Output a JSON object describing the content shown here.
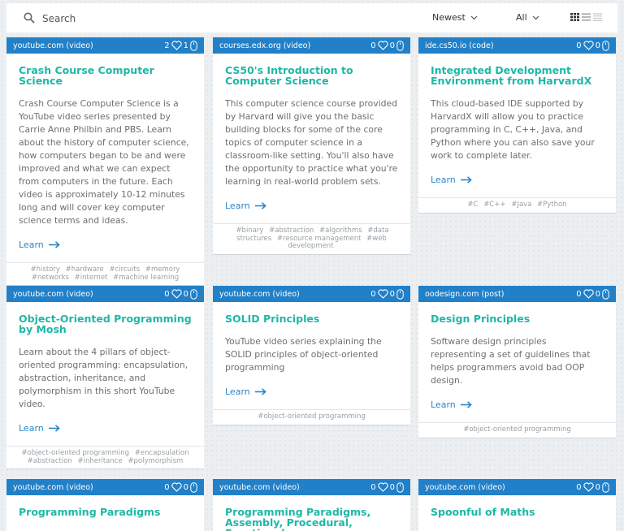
{
  "search": {
    "placeholder": "Search",
    "icon": "search-icon"
  },
  "sort": {
    "selected": "Newest",
    "icon": "chevron-down-icon"
  },
  "filter": {
    "selected": "All",
    "icon": "chevron-down-icon"
  },
  "view_modes": [
    "grid-view-icon",
    "list-view-icon",
    "compact-list-view-icon"
  ],
  "colors": {
    "header": "#2280c8",
    "title": "#1eb8a6",
    "link": "#2a86c9",
    "tag": "#9aa0a4"
  },
  "learn_label": "Learn",
  "cards": [
    {
      "source": "youtube.com (video)",
      "likes": "2",
      "clicks": "1",
      "title": "Crash Course Computer Science",
      "description": "Crash Course Computer Science is a YouTube video series presented by Carrie Anne Philbin and PBS. Learn about the history of computer science, how computers began to be and were improved and what we can expect from computers in the future. Each video is approximately 10-12 minutes long and will cover key computer science terms and ideas.",
      "tags": [
        "#history",
        "#hardware",
        "#circuits",
        "#memory",
        "#networks",
        "#internet",
        "#machine learning"
      ]
    },
    {
      "source": "courses.edx.org (video)",
      "likes": "0",
      "clicks": "0",
      "title": "CS50's Introduction to Computer Science",
      "description": "This computer science course provided by Harvard will give you the basic building blocks for some of the core topics of computer science in a classroom-like setting. You'll also have the opportunity to practice what you're learning in real-world problem sets.",
      "tags": [
        "#binary",
        "#abstraction",
        "#algorithms",
        "#data structures",
        "#resource management",
        "#web development"
      ]
    },
    {
      "source": "ide.cs50.io (code)",
      "likes": "0",
      "clicks": "0",
      "title": "Integrated Development Environment from HarvardX",
      "description": "This cloud-based IDE supported by HarvardX will allow you to practice programming in C, C++, Java, and Python where you can also save your work to complete later.",
      "tags": [
        "#C",
        "#C++",
        "#Java",
        "#Python"
      ]
    },
    {
      "source": "youtube.com (video)",
      "likes": "0",
      "clicks": "0",
      "title": "Object-Oriented Programming by Mosh",
      "description": "Learn about the 4 pillars of object-oriented programming: encapsulation, abstraction, inheritance, and polymorphism in this short YouTube video.",
      "tags": [
        "#object-oriented programming",
        "#encapsulation",
        "#abstraction",
        "#inheritance",
        "#polymorphism"
      ]
    },
    {
      "source": "youtube.com (video)",
      "likes": "0",
      "clicks": "0",
      "title": "SOLID Principles",
      "description": "YouTube video series explaining the SOLID principles of object-oriented programming",
      "tags": [
        "#object-oriented programming"
      ]
    },
    {
      "source": "oodesign.com (post)",
      "likes": "0",
      "clicks": "0",
      "title": "Design Principles",
      "description": "Software design principles representing a set of guidelines that helps programmers avoid bad OOP design.",
      "tags": [
        "#object-oriented programming"
      ]
    },
    {
      "source": "youtube.com (video)",
      "likes": "0",
      "clicks": "0",
      "title": "Programming Paradigms",
      "description": "",
      "tags": []
    },
    {
      "source": "youtube.com (video)",
      "likes": "0",
      "clicks": "0",
      "title": "Programming Paradigms, Assembly, Procedural, Functional",
      "description": "",
      "tags": []
    },
    {
      "source": "youtube.com (video)",
      "likes": "0",
      "clicks": "0",
      "title": "Spoonful of Maths",
      "description": "",
      "tags": []
    }
  ]
}
